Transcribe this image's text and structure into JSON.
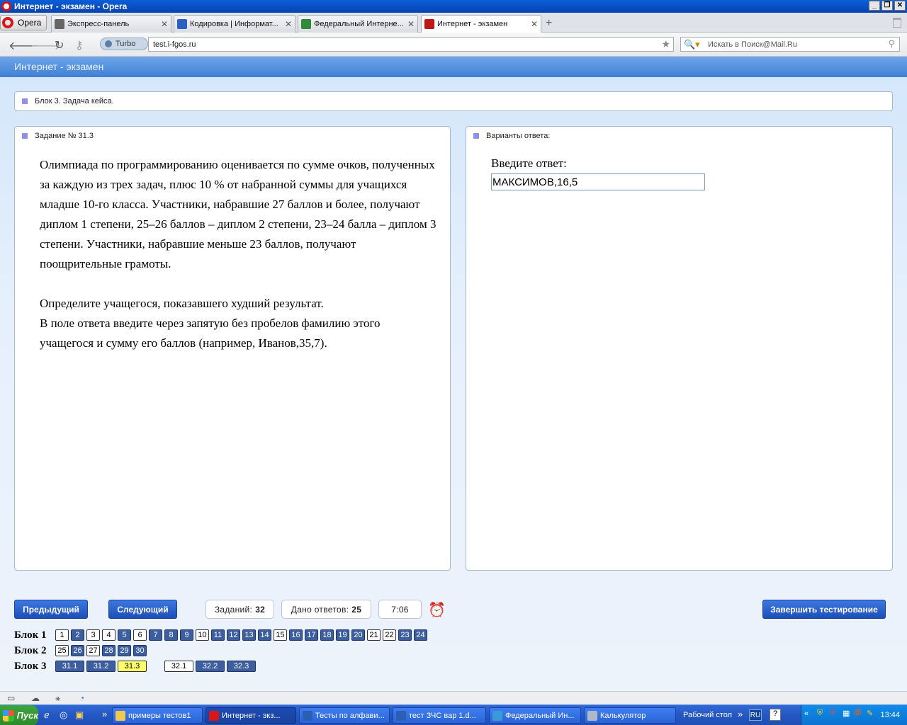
{
  "window": {
    "title": "Интернет - экзамен - Opera"
  },
  "browser": {
    "menu_label": "Opera",
    "tabs": [
      {
        "label": "Экспресс-панель",
        "color": "#666666"
      },
      {
        "label": "Кодировка | Информат...",
        "color": "#2a60c0"
      },
      {
        "label": "Федеральный Интерне...",
        "color": "#2f8a3a"
      },
      {
        "label": "Интернет - экзамен",
        "color": "#c01818"
      }
    ],
    "turbo_label": "Turbo",
    "url": "test.i-fgos.ru",
    "search_placeholder": "Искать в Поиск@Mail.Ru"
  },
  "page": {
    "header_title": "Интернет - экзамен",
    "block_title": "Блок 3. Задача кейса.",
    "task_title": "Задание № 31.3",
    "task_paragraphs": [
      "Олимпиада по программированию оценивается по сумме очков, полученных за каждую из трех задач, плюс 10 % от набранной суммы для учащихся младше 10-го класса. Участники, набравшие 27 баллов и более, получают диплом 1 степени, 25–26 баллов – диплом 2 степени, 23–24 балла – диплом 3 степени. Участники, набравшие меньше 23 баллов, получают поощрительные грамоты.",
      "Определите учащегося, показавшего худший результат.",
      "В поле ответа введите через запятую без пробелов фамилию этого учащегося и сумму его баллов (например, Иванов,35,7)."
    ],
    "answers_title": "Варианты ответа:",
    "answer_label": "Введите ответ:",
    "answer_value": "МАКСИМОВ,16,5"
  },
  "controls": {
    "prev_label": "Предыдущий",
    "next_label": "Следующий",
    "tasks_label": "Заданий:",
    "tasks_count": "32",
    "answered_label": "Дано ответов:",
    "answered_count": "25",
    "timer": "7:06",
    "finish_label": "Завершить тестирование"
  },
  "blocks": [
    {
      "label": "Блок 1",
      "items": [
        {
          "n": "1",
          "s": "un"
        },
        {
          "n": "2",
          "s": "ans"
        },
        {
          "n": "3",
          "s": "un"
        },
        {
          "n": "4",
          "s": "un"
        },
        {
          "n": "5",
          "s": "ans"
        },
        {
          "n": "6",
          "s": "un"
        },
        {
          "n": "7",
          "s": "ans"
        },
        {
          "n": "8",
          "s": "ans"
        },
        {
          "n": "9",
          "s": "ans"
        },
        {
          "n": "10",
          "s": "un"
        },
        {
          "n": "11",
          "s": "ans"
        },
        {
          "n": "12",
          "s": "ans"
        },
        {
          "n": "13",
          "s": "ans"
        },
        {
          "n": "14",
          "s": "ans"
        },
        {
          "n": "15",
          "s": "un"
        },
        {
          "n": "16",
          "s": "ans"
        },
        {
          "n": "17",
          "s": "ans"
        },
        {
          "n": "18",
          "s": "ans"
        },
        {
          "n": "19",
          "s": "ans"
        },
        {
          "n": "20",
          "s": "ans"
        },
        {
          "n": "21",
          "s": "un"
        },
        {
          "n": "22",
          "s": "un"
        },
        {
          "n": "23",
          "s": "ans"
        },
        {
          "n": "24",
          "s": "ans"
        }
      ]
    },
    {
      "label": "Блок 2",
      "items": [
        {
          "n": "25",
          "s": "un"
        },
        {
          "n": "26",
          "s": "ans"
        },
        {
          "n": "27",
          "s": "un"
        },
        {
          "n": "28",
          "s": "ans"
        },
        {
          "n": "29",
          "s": "ans"
        },
        {
          "n": "30",
          "s": "ans"
        }
      ]
    },
    {
      "label": "Блок 3",
      "items": [
        {
          "n": "31.1",
          "s": "ans"
        },
        {
          "n": "31.2",
          "s": "ans"
        },
        {
          "n": "31.3",
          "s": "cur"
        },
        {
          "n": "32.1",
          "s": "un",
          "gap": true
        },
        {
          "n": "32.2",
          "s": "ans"
        },
        {
          "n": "32.3",
          "s": "ans"
        }
      ]
    }
  ],
  "taskbar": {
    "start_label": "Пуск",
    "items": [
      {
        "label": "примеры тестов1",
        "color": "#f2c94c"
      },
      {
        "label": "Интернет - экз...",
        "color": "#d81818",
        "active": true
      },
      {
        "label": "Тесты по алфави...",
        "color": "#2b5fb3"
      },
      {
        "label": "тест ЗЧС вар 1.d...",
        "color": "#2b5fb3"
      },
      {
        "label": "Федеральный Ин...",
        "color": "#3a9ad9"
      },
      {
        "label": "Калькулятор",
        "color": "#b0b8c8"
      }
    ],
    "desktop_label": "Рабочий стол",
    "lang": "RU",
    "time": "13:44"
  }
}
